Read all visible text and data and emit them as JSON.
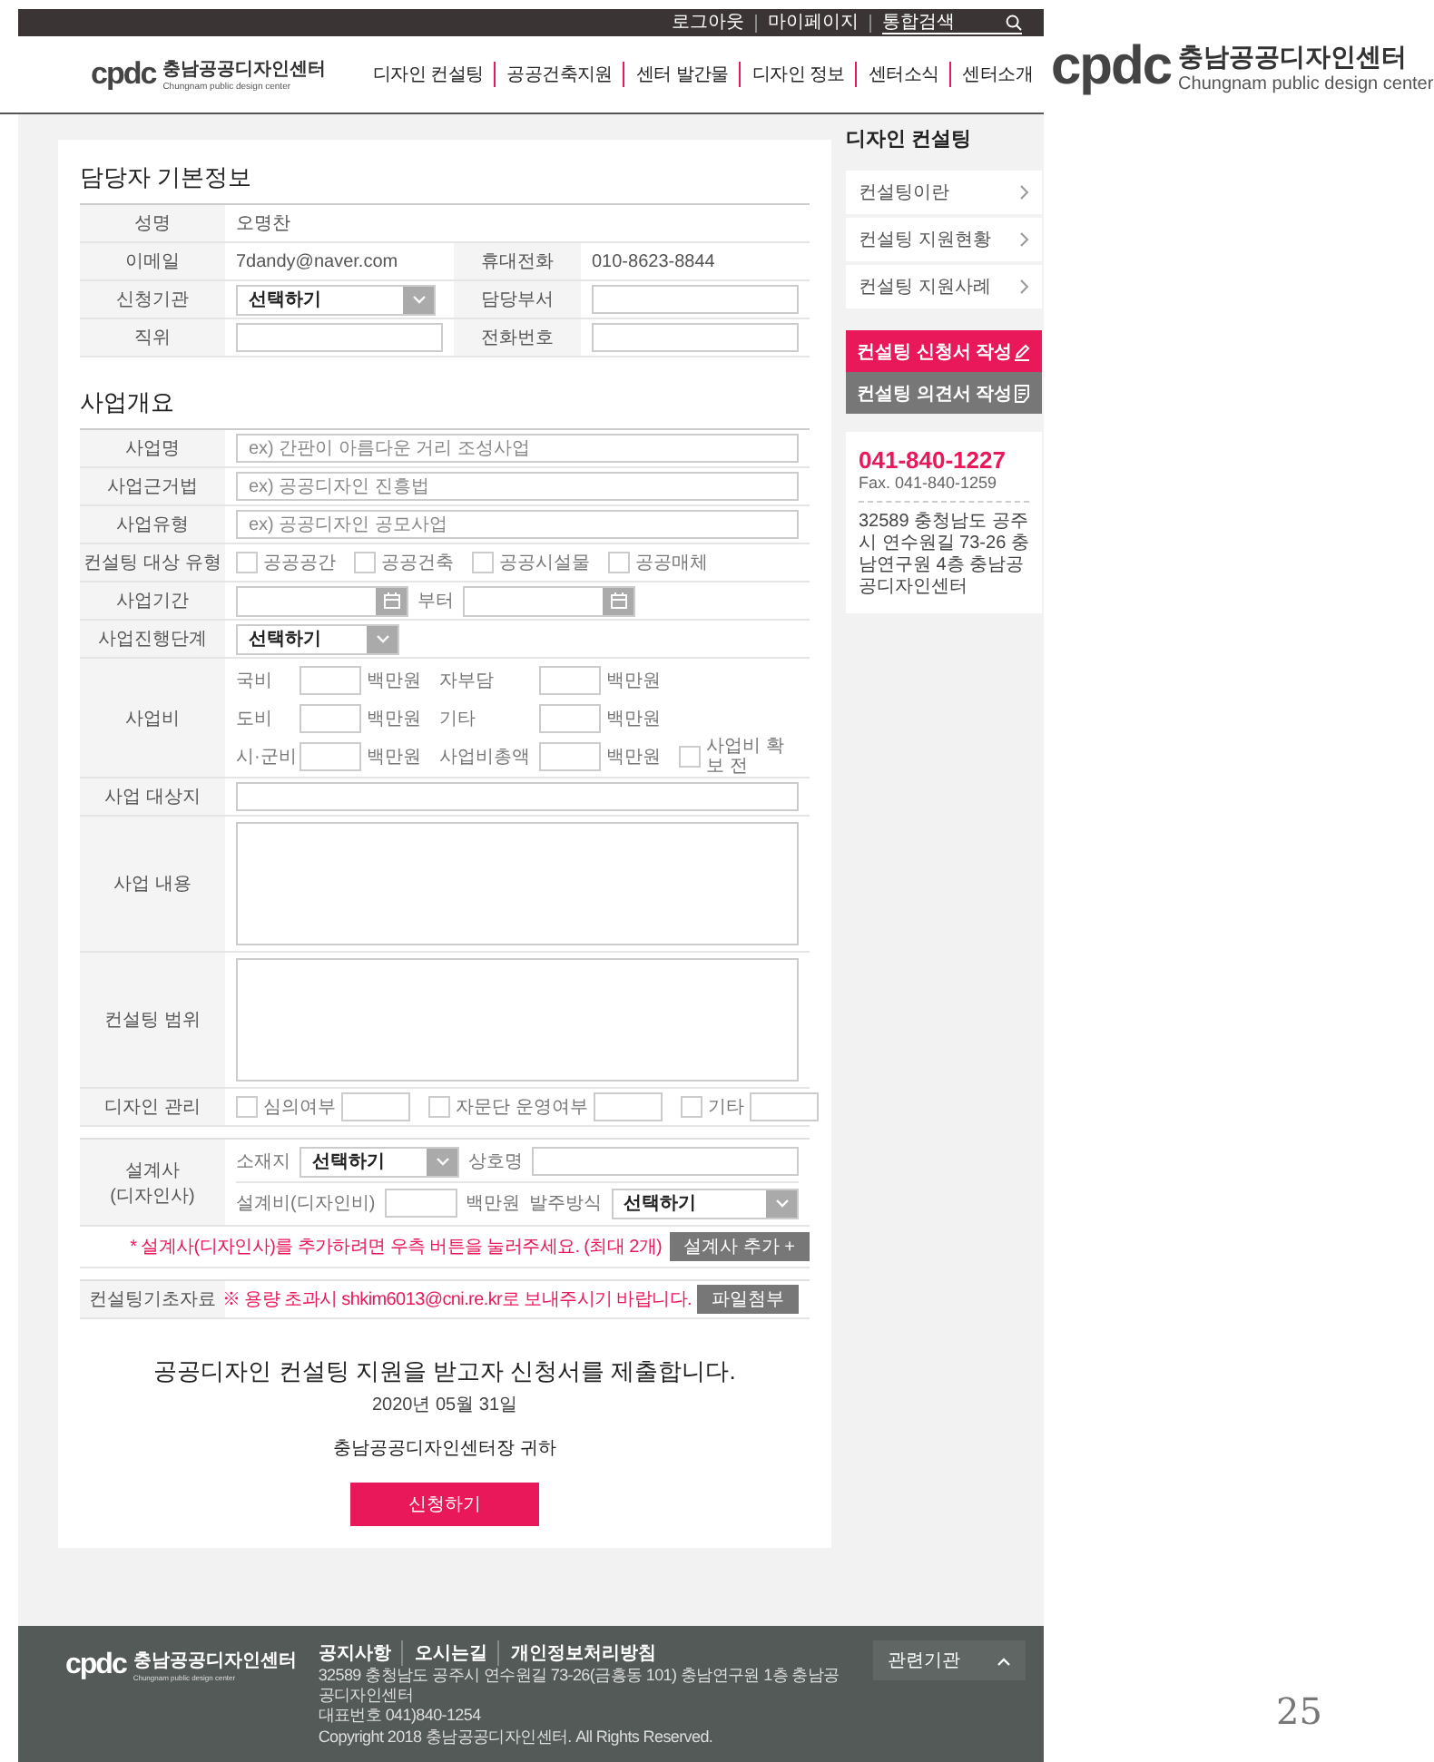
{
  "top_bar": {
    "links": [
      "로그아웃",
      "마이페이지"
    ],
    "search": {
      "placeholder": "통합검색"
    }
  },
  "header": {
    "logo": {
      "mark": "cpdc",
      "name": "충남공공디자인센터",
      "subtitle": "Chungnam public design center"
    },
    "nav": [
      "디자인 컨설팅",
      "공공건축지원",
      "센터 발간물",
      "디자인 정보",
      "센터소식",
      "센터소개"
    ]
  },
  "applicant": {
    "title": "담당자 기본정보",
    "rows": [
      {
        "cells": [
          {
            "label": "성명",
            "field": {
              "kind": "text",
              "value": "오명찬"
            }
          }
        ]
      },
      {
        "cells": [
          {
            "label": "이메일",
            "field": {
              "kind": "text",
              "value": "7dandy@naver.com"
            }
          },
          {
            "label": "휴대전화",
            "field": {
              "kind": "text",
              "value": "010-8623-8844"
            }
          }
        ]
      },
      {
        "cells": [
          {
            "label": "신청기관",
            "field": {
              "kind": "select",
              "value": "선택하기"
            }
          },
          {
            "label": "담당부서",
            "field": {
              "kind": "input"
            }
          }
        ]
      },
      {
        "cells": [
          {
            "label": "직위",
            "field": {
              "kind": "input"
            }
          },
          {
            "label": "전화번호",
            "field": {
              "kind": "input"
            }
          }
        ]
      }
    ]
  },
  "overview": {
    "title": "사업개요",
    "rows": [
      {
        "kind": "input",
        "label": "사업명",
        "placeholder": "ex) 간판이 아름다운 거리 조성사업"
      },
      {
        "kind": "input",
        "label": "사업근거법",
        "placeholder": "ex) 공공디자인 진흥법"
      },
      {
        "kind": "input",
        "label": "사업유형",
        "placeholder": "ex) 공공디자인 공모사업"
      },
      {
        "kind": "checkboxes",
        "label": "컨설팅 대상 유형",
        "options": [
          {
            "label": "공공공간",
            "checked": false
          },
          {
            "label": "공공건축",
            "checked": false
          },
          {
            "label": "공공시설물",
            "checked": false
          },
          {
            "label": "공공매체",
            "checked": false
          }
        ]
      },
      {
        "kind": "period",
        "label": "사업기간",
        "between": "부터"
      },
      {
        "kind": "select",
        "label": "사업진행단계",
        "value": "선택하기"
      },
      {
        "kind": "budget",
        "label": "사업비",
        "items": [
          {
            "label": "국비",
            "unit": "백만원"
          },
          {
            "label": "자부담",
            "unit": "백만원"
          },
          {
            "label": "도비",
            "unit": "백만원"
          },
          {
            "label": "기타",
            "unit": "백만원"
          },
          {
            "label": "시·군비",
            "unit": "백만원"
          },
          {
            "label": "사업비총액",
            "unit": "백만원"
          }
        ],
        "option": {
          "label": "사업비 확보 전",
          "checked": false
        }
      },
      {
        "kind": "input",
        "label": "사업 대상지"
      },
      {
        "kind": "textarea",
        "label": "사업 내용"
      },
      {
        "kind": "textarea",
        "label": "컨설팅 범위"
      },
      {
        "kind": "checked_inputs",
        "label": "디자인 관리",
        "options": [
          {
            "label": "심의여부",
            "checked": false
          },
          {
            "label": "자문단 운영여부",
            "checked": false
          },
          {
            "label": "기타",
            "checked": false
          }
        ]
      },
      {
        "kind": "designer",
        "label": "설계사\n(디자인사)",
        "location": {
          "label": "소재지",
          "value": "선택하기"
        },
        "company": {
          "label": "상호명"
        },
        "fee": {
          "label": "설계비(디자인비)",
          "unit": "백만원"
        },
        "ordering": {
          "label": "발주방식",
          "value": "선택하기"
        }
      },
      {
        "kind": "note",
        "text": "* 설계사(디자인사)를 추가하려면 우측 버튼을 눌러주세요. (최대 2개)",
        "button": "설계사 추가 +"
      },
      {
        "kind": "attachment",
        "label": "컨설팅기초자료",
        "note": "※ 용량 초과시 shkim6013@cni.re.kr로 보내주시기 바랍니다.",
        "button": "파일첨부"
      }
    ]
  },
  "closing": {
    "statement": "공공디자인 컨설팅 지원을 받고자 신청서를 제출합니다.",
    "date": "2020년 05월 31일",
    "recipient": "충남공공디자인센터장 귀하",
    "submit": "신청하기"
  },
  "sidebar": {
    "title": "디자인 컨설팅",
    "items": [
      "컨설팅이란",
      "컨설팅 지원현황",
      "컨설팅 지원사례"
    ],
    "actions": [
      {
        "label": "컨설팅 신청서 작성",
        "selected": true
      },
      {
        "label": "컨설팅 의견서 작성",
        "selected": false
      }
    ],
    "contact": {
      "phone": "041-840-1227",
      "fax": "Fax. 041-840-1259",
      "address": "32589 충청남도 공주시 연수원길 73-26 충남연구원 4층 충남공공디자인센터"
    }
  },
  "footer": {
    "logo": {
      "mark": "cpdc",
      "name": "충남공공디자인센터",
      "subtitle": "Chungnam public design center"
    },
    "links": [
      "공지사항",
      "오시는길",
      "개인정보처리방침"
    ],
    "address": "32589 충청남도 공주시 연수원길 73-26(금흥동 101) 충남연구원 1층 충남공공디자인센터",
    "phone": "대표번호 041)840-1254",
    "copyright": "Copyright 2018 충남공공디자인센터. All Rights Reserved.",
    "related": "관련기관"
  },
  "side_logo": {
    "mark": "cpdc",
    "name": "충남공공디자인센터",
    "subtitle": "Chungnam public design center"
  },
  "page_number": "25"
}
